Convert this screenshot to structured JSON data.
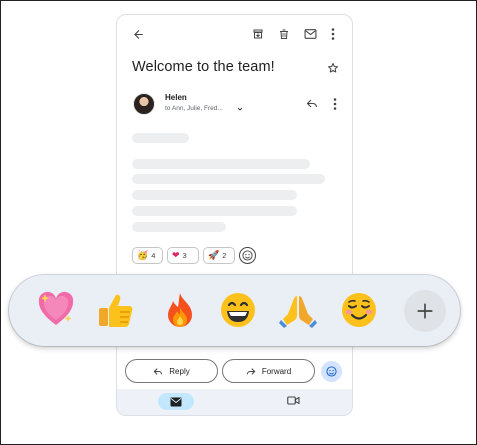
{
  "email": {
    "subject": "Welcome to the team!",
    "sender": "Helen",
    "recipients": "to Ann, Julie, Fred..."
  },
  "toolbar": {
    "icons": [
      "back-arrow-icon",
      "archive-icon",
      "delete-icon",
      "mark-unread-icon",
      "more-vert-icon"
    ]
  },
  "reactions": [
    {
      "icon": "party-face-emoji",
      "count": "4"
    },
    {
      "icon": "red-heart-emoji",
      "count": "3"
    },
    {
      "icon": "rocket-emoji",
      "count": "2"
    }
  ],
  "actions": {
    "reply_label": "Reply",
    "forward_label": "Forward"
  },
  "emoji_tray": {
    "emojis": [
      "sparkling-heart",
      "thumbs-up",
      "fire",
      "grinning-face",
      "folded-hands",
      "smiling-face"
    ]
  },
  "colors": {
    "tray_bg": "#eaeef5",
    "nav_bg": "#eef2f8",
    "nav_active": "#c2e7ff",
    "accent": "#0b57d0"
  }
}
